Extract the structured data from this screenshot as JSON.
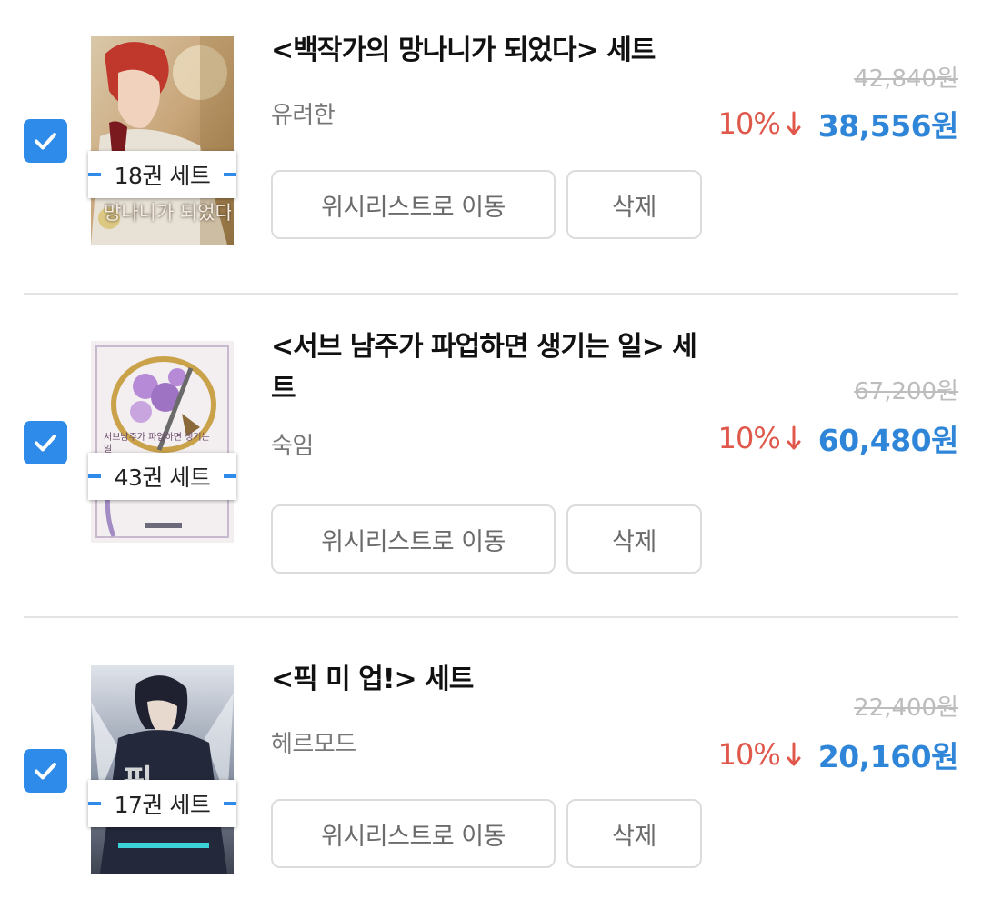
{
  "cart_items": [
    {
      "checked": true,
      "title": "<백작가의 망나니가 되었다> 세트",
      "author": "유려한",
      "volume_badge": "18권 세트",
      "cover_text": "망나니가 되었다",
      "original_price": "42,840원",
      "discount": "10%",
      "price": "38,556원",
      "wishlist_label": "위시리스트로 이동",
      "delete_label": "삭제"
    },
    {
      "checked": true,
      "title": "<서브 남주가 파업하면 생기는 일> 세트",
      "author": "숙임",
      "volume_badge": "43권 세트",
      "cover_text": "서브남주가 파업하면 생기는 일",
      "original_price": "67,200원",
      "discount": "10%",
      "price": "60,480원",
      "wishlist_label": "위시리스트로 이동",
      "delete_label": "삭제"
    },
    {
      "checked": true,
      "title": "<픽 미 업!> 세트",
      "author": "헤르모드",
      "volume_badge": "17권 세트",
      "cover_text": "픽 미 업",
      "original_price": "22,400원",
      "discount": "10%",
      "price": "20,160원",
      "wishlist_label": "위시리스트로 이동",
      "delete_label": "삭제"
    }
  ],
  "colors": {
    "accent_blue": "#2f8bea",
    "price_blue": "#2f86d8",
    "discount_red": "#e0584b",
    "strike_gray": "#bdbdbd"
  },
  "icons": [
    "check-icon",
    "down-arrow-icon"
  ]
}
